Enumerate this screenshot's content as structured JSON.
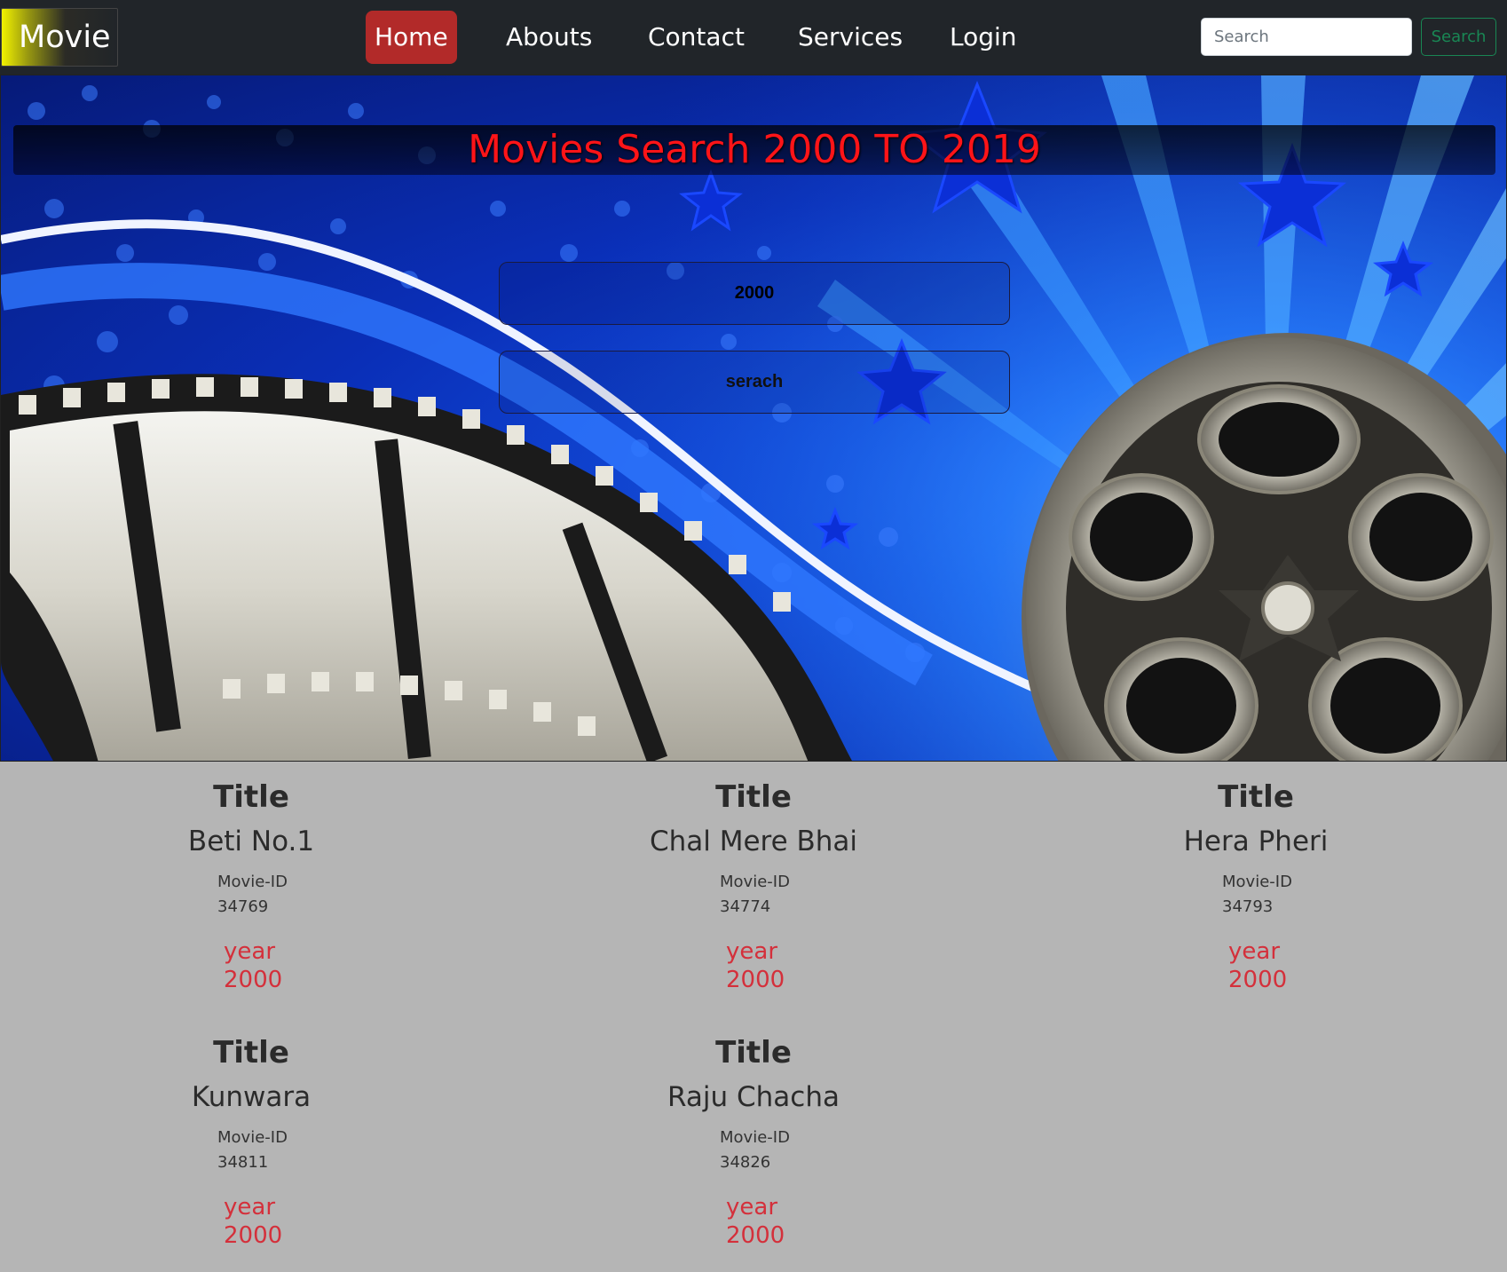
{
  "nav": {
    "brand": "Movie",
    "links": [
      "Home",
      "Abouts",
      "Contact",
      "Services",
      "Login"
    ],
    "active": "Home",
    "search_placeholder": "Search",
    "search_button": "Search"
  },
  "hero": {
    "title": "Movies Search 2000 TO 2019",
    "year_input": "2000",
    "search_button": "serach"
  },
  "movies": [
    {
      "title_label": "Title",
      "title": "Beti No.1",
      "id_label": "Movie-ID",
      "id": "34769",
      "year_label": "year",
      "year": "2000"
    },
    {
      "title_label": "Title",
      "title": "Chal Mere Bhai",
      "id_label": "Movie-ID",
      "id": "34774",
      "year_label": "year",
      "year": "2000"
    },
    {
      "title_label": "Title",
      "title": "Hera Pheri",
      "id_label": "Movie-ID",
      "id": "34793",
      "year_label": "year",
      "year": "2000"
    },
    {
      "title_label": "Title",
      "title": "Kunwara",
      "id_label": "Movie-ID",
      "id": "34811",
      "year_label": "year",
      "year": "2000"
    },
    {
      "title_label": "Title",
      "title": "Raju Chacha",
      "id_label": "Movie-ID",
      "id": "34826",
      "year_label": "year",
      "year": "2000"
    }
  ],
  "colors": {
    "navbar": "#212529",
    "active_nav": "#b22a29",
    "hero_title": "#ff1418",
    "year_text": "#d4303b",
    "page_bg": "#b5b5b5",
    "search_button": "#198754"
  }
}
